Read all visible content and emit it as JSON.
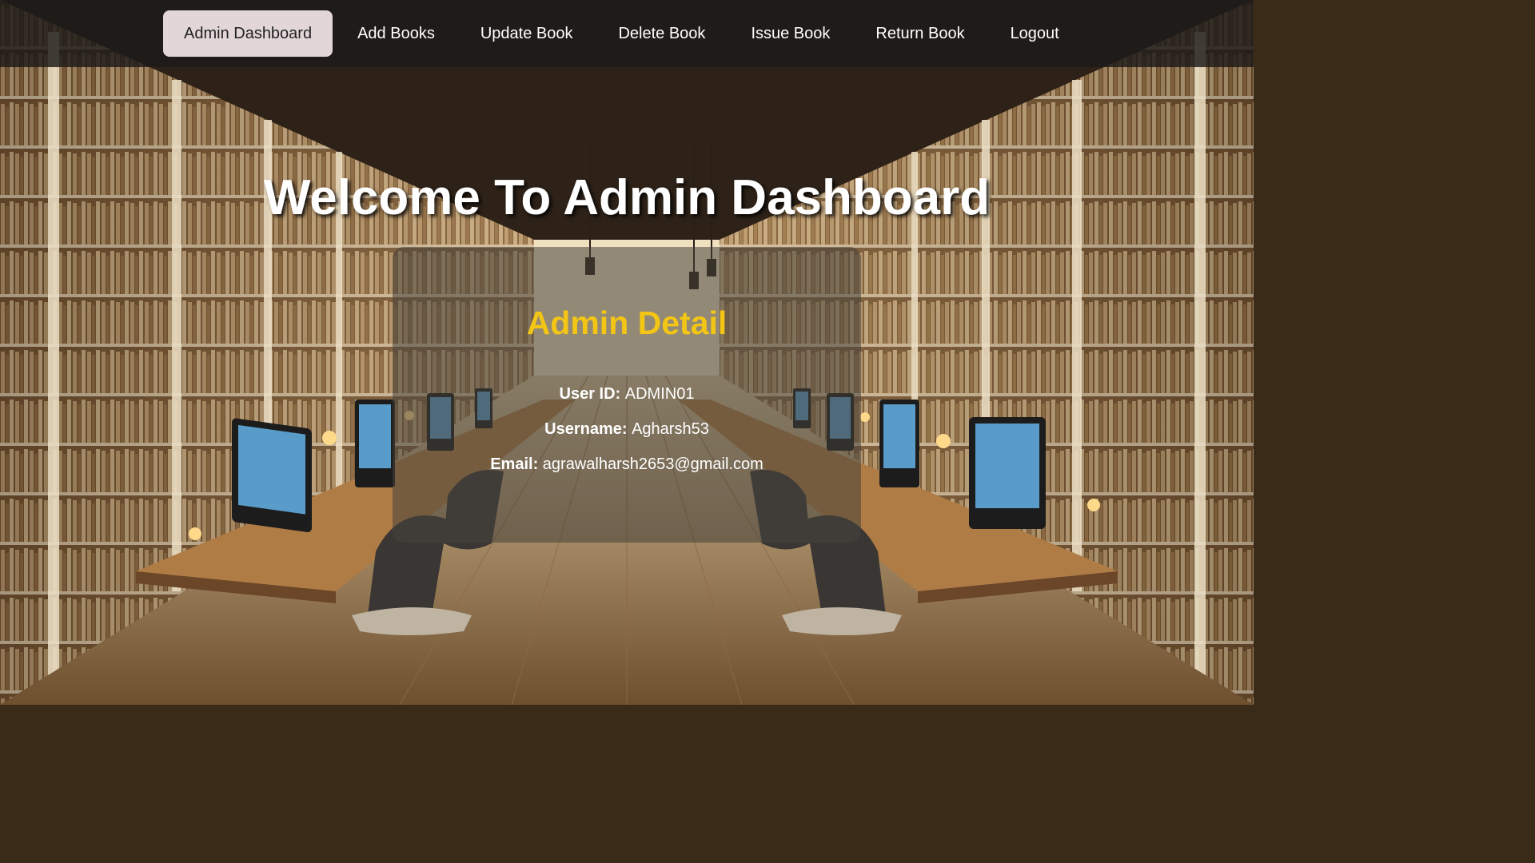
{
  "nav": {
    "items": [
      {
        "label": "Admin Dashboard",
        "active": true
      },
      {
        "label": "Add Books",
        "active": false
      },
      {
        "label": "Update Book",
        "active": false
      },
      {
        "label": "Delete Book",
        "active": false
      },
      {
        "label": "Issue Book",
        "active": false
      },
      {
        "label": "Return Book",
        "active": false
      },
      {
        "label": "Logout",
        "active": false
      }
    ]
  },
  "page": {
    "heading": "Welcome To Admin Dashboard"
  },
  "card": {
    "title": "Admin Detail",
    "user_id_label": "User ID:",
    "user_id": "ADMIN01",
    "username_label": "Username:",
    "username": "Agharsh53",
    "email_label": "Email:",
    "email": "agrawalharsh2653@gmail.com"
  },
  "colors": {
    "nav_active_bg": "#e3d6d8",
    "card_title": "#f3c515",
    "heading": "#ffffff"
  },
  "background": {
    "scene": "library-hall-with-computers"
  }
}
